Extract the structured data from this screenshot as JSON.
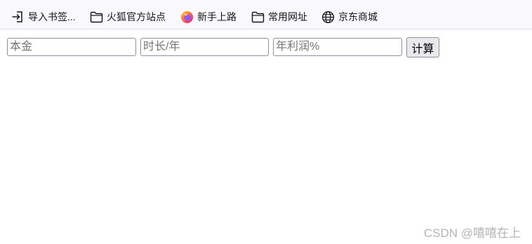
{
  "bookmarks_toolbar": {
    "items": [
      {
        "label": "导入书签...",
        "icon": "import-icon"
      },
      {
        "label": "火狐官方站点",
        "icon": "folder-icon"
      },
      {
        "label": "新手上路",
        "icon": "firefox-icon"
      },
      {
        "label": "常用网址",
        "icon": "folder-icon"
      },
      {
        "label": "京东商城",
        "icon": "globe-icon"
      }
    ]
  },
  "form": {
    "principal_placeholder": "本金",
    "duration_placeholder": "时长/年",
    "rate_placeholder": "年利润%",
    "calculate_label": "计算"
  },
  "watermark": "CSDN @嘻嘻在上",
  "colors": {
    "toolbar_bg": "#f9f9fb",
    "button_bg": "#e9e9ed",
    "firefox_orange": "#ff7139",
    "firefox_purple": "#9059ff"
  }
}
